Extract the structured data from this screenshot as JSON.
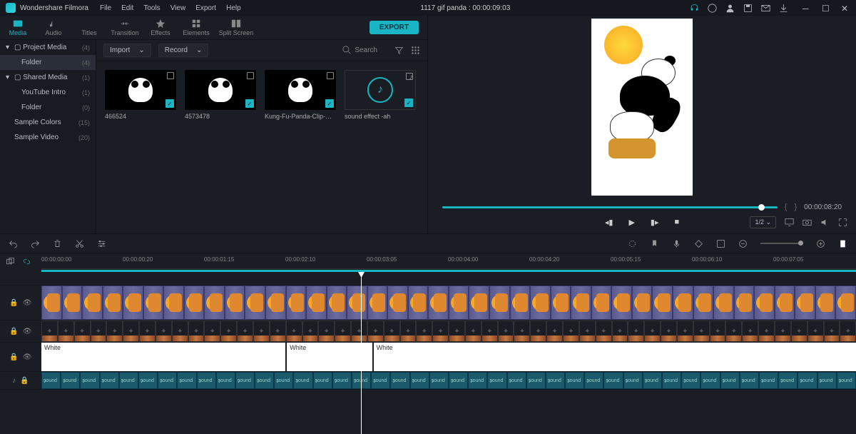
{
  "app": {
    "title": "Wondershare Filmora",
    "project": "1117 gif panda : 00:00:09:03"
  },
  "menu": [
    "File",
    "Edit",
    "Tools",
    "View",
    "Export",
    "Help"
  ],
  "tabs": [
    {
      "id": "media",
      "label": "Media"
    },
    {
      "id": "audio",
      "label": "Audio"
    },
    {
      "id": "titles",
      "label": "Titles"
    },
    {
      "id": "transition",
      "label": "Transition"
    },
    {
      "id": "effects",
      "label": "Effects"
    },
    {
      "id": "elements",
      "label": "Elements"
    },
    {
      "id": "split",
      "label": "Split Screen"
    }
  ],
  "export_label": "EXPORT",
  "sidebar": [
    {
      "label": "Project Media",
      "count": "(4)",
      "caret": true,
      "folder": true,
      "indent": 0
    },
    {
      "label": "Folder",
      "count": "(4)",
      "active": true,
      "indent": 1
    },
    {
      "label": "Shared Media",
      "count": "(1)",
      "caret": true,
      "folder": true,
      "indent": 0
    },
    {
      "label": "YouTube Intro",
      "count": "(1)",
      "indent": 1
    },
    {
      "label": "Folder",
      "count": "(0)",
      "indent": 1
    },
    {
      "label": "Sample Colors",
      "count": "(15)",
      "indent": 0,
      "noarrow": true
    },
    {
      "label": "Sample Video",
      "count": "(20)",
      "indent": 0,
      "noarrow": true
    }
  ],
  "toolbar": {
    "import": "Import",
    "record": "Record",
    "search": "Search"
  },
  "media": [
    {
      "name": "466524",
      "type": "video"
    },
    {
      "name": "4573478",
      "type": "video"
    },
    {
      "name": "Kung-Fu-Panda-Clip-Art...",
      "type": "video"
    },
    {
      "name": "sound effect -ah",
      "type": "audio"
    }
  ],
  "preview": {
    "time": "00:00:08:20",
    "ratio": "1/2"
  },
  "ruler": [
    "00:00:00:00",
    "00:00:00:20",
    "00:00:01:15",
    "00:00:02:10",
    "00:00:03:05",
    "00:00:04:00",
    "00:00:04:20",
    "00:00:05:15",
    "00:00:06:10",
    "00:00:07:05"
  ],
  "white_clips": [
    "White",
    "White",
    "White"
  ],
  "audio_label": "sound"
}
